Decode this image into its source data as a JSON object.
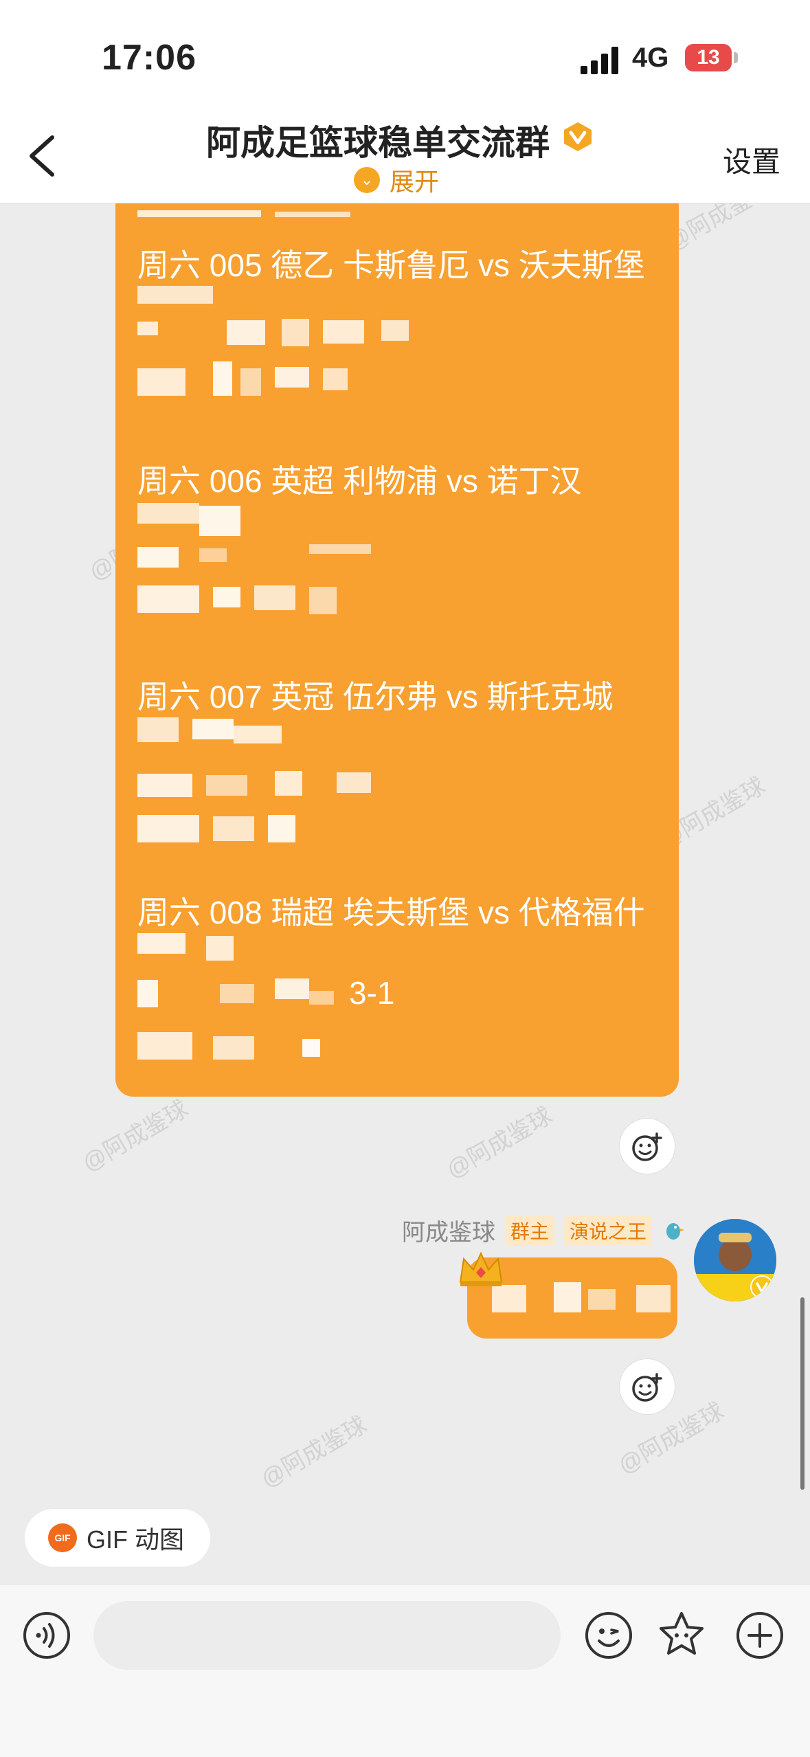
{
  "status_bar": {
    "time": "17:06",
    "network": "4G",
    "battery": "13"
  },
  "nav": {
    "title": "阿成足篮球稳单交流群",
    "expand_label": "展开",
    "settings_label": "设置"
  },
  "matches": [
    "周六 005 德乙 卡斯鲁厄 vs 沃夫斯堡",
    "周六 006 英超 利物浦 vs 诺丁汉",
    "周六 007 英冠 伍尔弗 vs 斯托克城",
    "周六 008 瑞超 埃夫斯堡 vs 代格福什"
  ],
  "partial_text": {
    "score_fragment": "3-1"
  },
  "sender": {
    "name": "阿成鉴球",
    "tag_owner": "群主",
    "tag_title": "演说之王"
  },
  "watermark": "@阿成鉴球",
  "gif_button_label": "GIF 动图",
  "gif_icon_text": "GIF",
  "icons": {
    "back": "chevron-left-icon",
    "verified": "v-badge-icon",
    "react": "add-reaction-icon",
    "voice": "voice-icon",
    "emoji": "emoji-icon",
    "sticker": "sticker-icon",
    "plus": "plus-icon"
  },
  "colors": {
    "bubble": "#f8a030",
    "accent": "#e08a10"
  }
}
